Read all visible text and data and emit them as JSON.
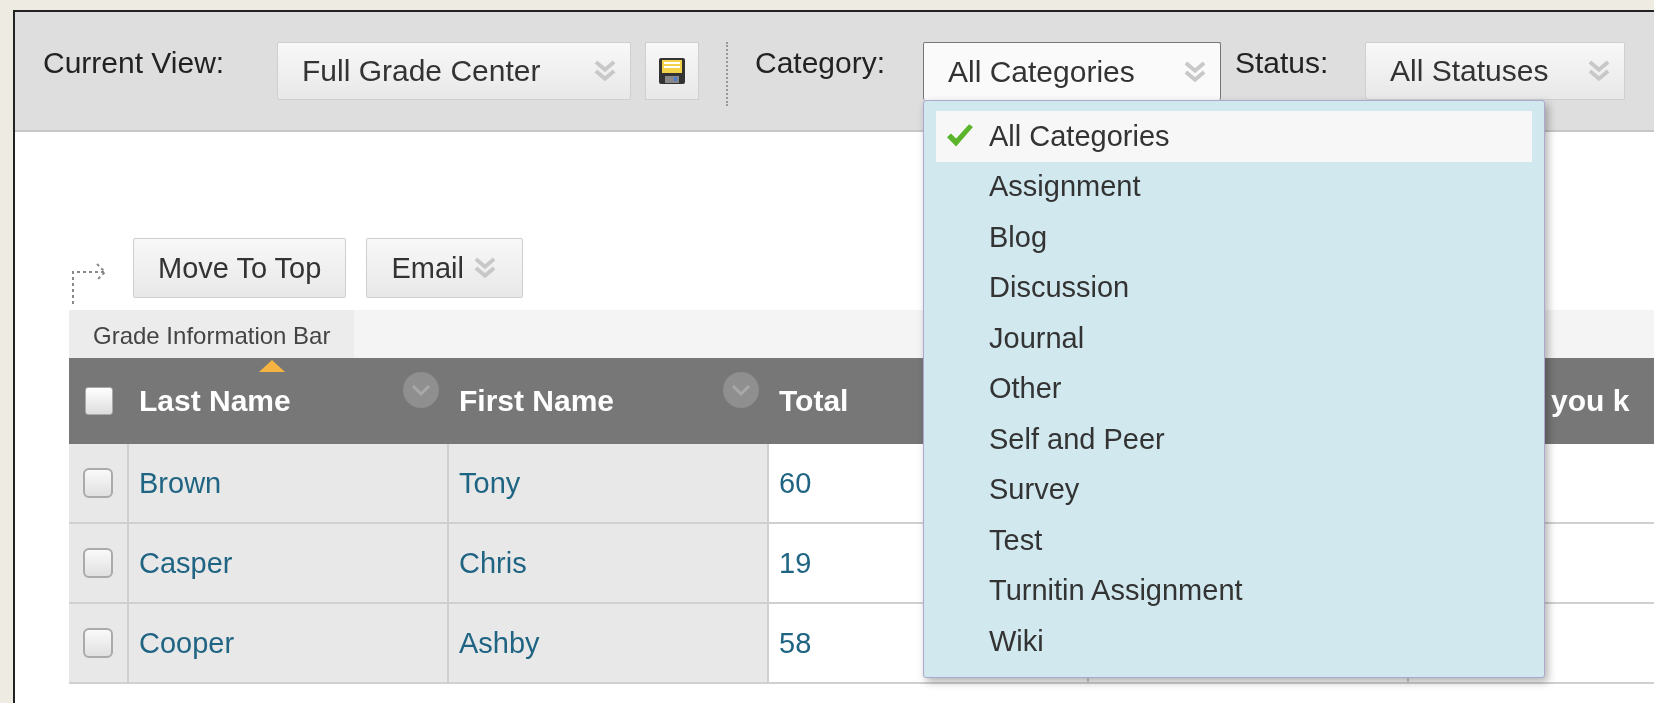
{
  "toolbar": {
    "current_view": {
      "label": "Current View:",
      "value": "Full Grade Center"
    },
    "category": {
      "label": "Category:",
      "value": "All Categories",
      "expanded": true
    },
    "status": {
      "label": "Status:",
      "value": "All Statuses"
    }
  },
  "category_menu": [
    {
      "label": "All Categories",
      "selected": true
    },
    {
      "label": "Assignment",
      "selected": false
    },
    {
      "label": "Blog",
      "selected": false
    },
    {
      "label": "Discussion",
      "selected": false
    },
    {
      "label": "Journal",
      "selected": false
    },
    {
      "label": "Other",
      "selected": false
    },
    {
      "label": "Self and Peer",
      "selected": false
    },
    {
      "label": "Survey",
      "selected": false
    },
    {
      "label": "Test",
      "selected": false
    },
    {
      "label": "Turnitin Assignment",
      "selected": false
    },
    {
      "label": "Wiki",
      "selected": false
    }
  ],
  "actions": [
    {
      "label": "Move To Top",
      "kind": "button"
    },
    {
      "label": "Email",
      "kind": "menu"
    }
  ],
  "info_bar": {
    "tab": "Grade Information Bar"
  },
  "table": {
    "all_checked": false,
    "columns": [
      {
        "label": "Last Name",
        "sorted": true,
        "menu": true
      },
      {
        "label": "First Name",
        "sorted": false,
        "menu": true
      },
      {
        "label": "Total",
        "sorted": false,
        "menu": false
      },
      {
        "sorted": false,
        "menu": false
      },
      {
        "label": "you k",
        "sorted": false,
        "menu": false
      }
    ],
    "rows": [
      {
        "checked": false,
        "cells": [
          "Brown",
          "Tony",
          "60"
        ]
      },
      {
        "checked": false,
        "cells": [
          "Casper",
          "Chris",
          "19"
        ]
      },
      {
        "checked": false,
        "cells": [
          "Cooper",
          "Ashby",
          "58"
        ]
      }
    ]
  }
}
